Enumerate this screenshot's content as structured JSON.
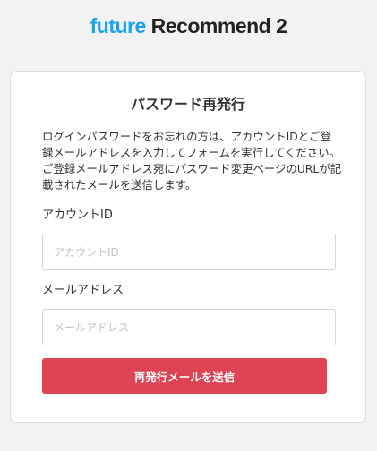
{
  "header": {
    "logo_part1": "future",
    "logo_part2": " Recommend 2"
  },
  "form": {
    "title": "パスワード再発行",
    "description_1": "ログインパスワードをお忘れの方は、アカウントIDとご登録メールアドレスを入力してフォームを実行してください。",
    "description_2": "ご登録メールアドレス宛にパスワード変更ページのURLが記載されたメールを送信します。",
    "account_label": "アカウントID",
    "account_placeholder": "アカウントID",
    "email_label": "メールアドレス",
    "email_placeholder": "メールアドレス",
    "submit_label": "再発行メールを送信"
  },
  "colors": {
    "accent_blue": "#1aa3e8",
    "button_red": "#de4353",
    "background": "#f2f2f2"
  }
}
